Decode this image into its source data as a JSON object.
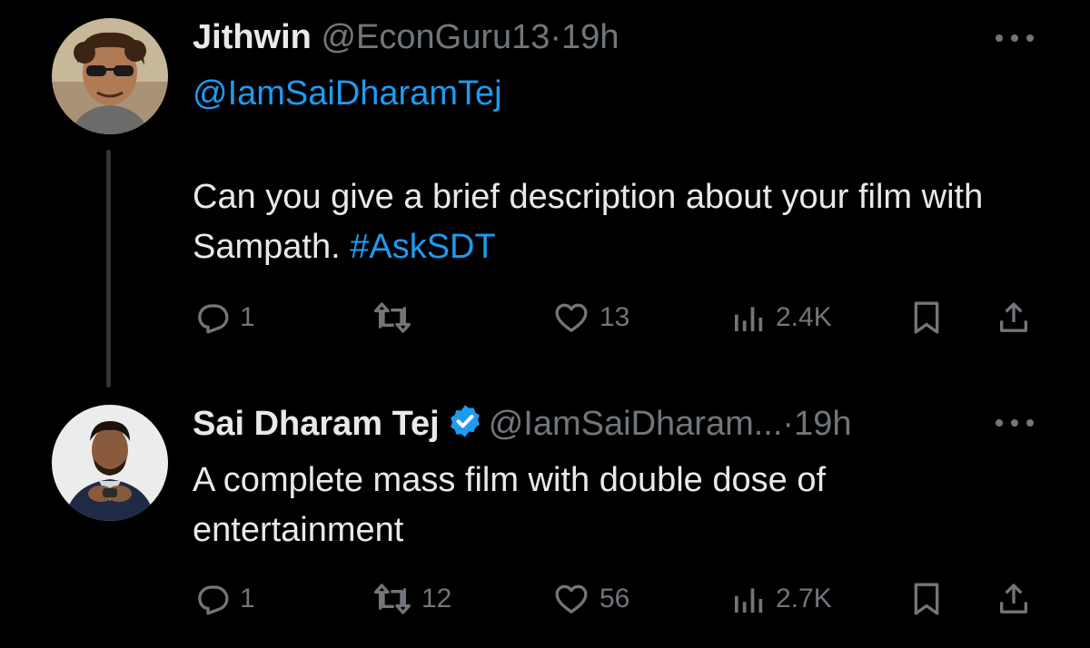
{
  "thread": [
    {
      "author": {
        "name": "Jithwin",
        "handle": "@EconGuru13",
        "verified": false,
        "avatar": "avatar-man-sunglasses"
      },
      "separator": "·",
      "time": "19h",
      "mention": "@IamSaiDharamTej",
      "text": "Can you give a brief description about your film with Sampath.",
      "hashtag": "#AskSDT",
      "stats": {
        "replies": "1",
        "retweets": "",
        "likes": "13",
        "views": "2.4K"
      }
    },
    {
      "author": {
        "name": "Sai Dharam Tej",
        "handle": "@IamSaiDharam...",
        "verified": true,
        "avatar": "avatar-man-suit"
      },
      "separator": "·",
      "time": "19h",
      "text": "A complete mass film with double dose of entertainment",
      "stats": {
        "replies": "1",
        "retweets": "12",
        "likes": "56",
        "views": "2.7K"
      }
    }
  ],
  "colors": {
    "background": "#000000",
    "text": "#e7e9ea",
    "muted": "#71767b",
    "accent": "#1d9bf0",
    "thread_line": "#333639"
  },
  "icons": {
    "reply": "reply-icon",
    "retweet": "retweet-icon",
    "like": "heart-icon",
    "views": "views-icon",
    "bookmark": "bookmark-icon",
    "share": "share-icon",
    "more": "more-icon",
    "verified": "verified-badge-icon"
  }
}
